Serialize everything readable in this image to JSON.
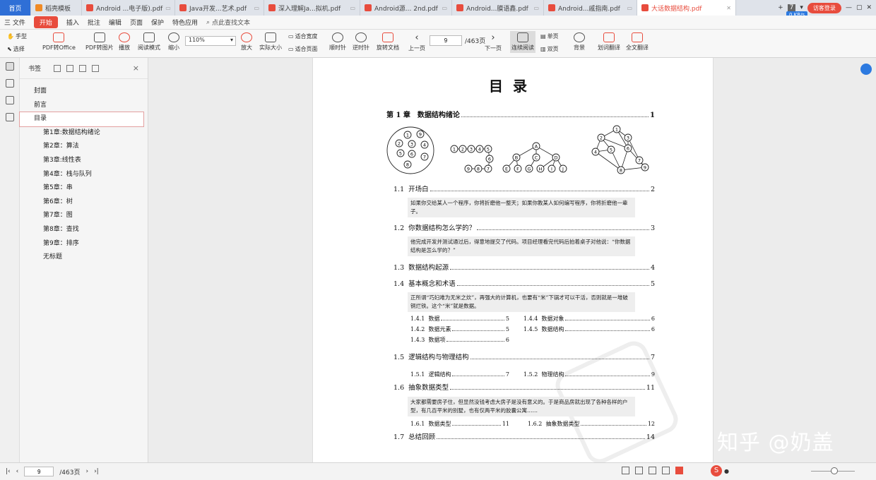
{
  "tabs": [
    {
      "label": "首页",
      "kind": "home"
    },
    {
      "label": "稻壳模板",
      "kind": "orange"
    },
    {
      "label": "Android ...电子版).pdf",
      "kind": "pdf"
    },
    {
      "label": "Java开发...艺术.pdf",
      "kind": "pdf"
    },
    {
      "label": "深入理解Ja...拟机.pdf",
      "kind": "pdf"
    },
    {
      "label": "Android源... 2nd.pdf",
      "kind": "pdf"
    },
    {
      "label": "Android...膜语鑫.pdf",
      "kind": "pdf"
    },
    {
      "label": "Android...戚指南.pdf",
      "kind": "pdf"
    },
    {
      "label": "大话数据结构.pdf",
      "kind": "active"
    }
  ],
  "tab_count": "7",
  "visit_login": "访客登录",
  "net_speed": "0 KB/s",
  "menu": {
    "file": "三 文件",
    "start": "开始",
    "items": [
      "插入",
      "批注",
      "编辑",
      "页面",
      "保护",
      "特色应用"
    ],
    "search": "点此查找文本"
  },
  "ribbon": {
    "hand": "手型",
    "select": "选择",
    "pdf_office": "PDF转Office",
    "pdf_image": "PDF转图片",
    "play": "播放",
    "read_mode": "阅读模式",
    "zoom_value": "110%",
    "shrink": "缩小",
    "enlarge": "放大",
    "actual": "实际大小",
    "fit_width": "适合宽度",
    "fit_page": "适合页面",
    "cw": "顺时针",
    "ccw": "逆时针",
    "rotate": "旋转文档",
    "prev": "上一页",
    "page_num": "9",
    "page_total": "/463页",
    "next": "下一页",
    "continuous": "连续阅读",
    "single": "单页",
    "double": "双页",
    "background": "背景",
    "line_translate": "划词翻译",
    "full_translate": "全文翻译"
  },
  "bookmarks": {
    "title": "书签",
    "items": [
      {
        "label": "封面",
        "level": 0
      },
      {
        "label": "前言",
        "level": 0
      },
      {
        "label": "目录",
        "level": 0,
        "selected": true
      },
      {
        "label": "第1章:数据结构绪论",
        "level": 1
      },
      {
        "label": "第2章：算法",
        "level": 1
      },
      {
        "label": "第3章:线性表",
        "level": 1
      },
      {
        "label": "第4章：栈与队列",
        "level": 1
      },
      {
        "label": "第5章：串",
        "level": 1
      },
      {
        "label": "第6章：树",
        "level": 1
      },
      {
        "label": "第7章：图",
        "level": 1
      },
      {
        "label": "第8章：查找",
        "level": 1
      },
      {
        "label": "第9章：排序",
        "level": 1
      },
      {
        "label": "无标题",
        "level": 1
      }
    ]
  },
  "document": {
    "title": "目录",
    "chapter": {
      "label": "第 1 章　数据结构绪论",
      "page": "1"
    },
    "sections": [
      {
        "num": "1.1",
        "label": "开场白",
        "page": "2"
      },
      {
        "num": "1.2",
        "label": "你数据结构怎么学的？",
        "page": "3"
      },
      {
        "num": "1.3",
        "label": "数据结构起源",
        "page": "4"
      },
      {
        "num": "1.4",
        "label": "基本概念和术语",
        "page": "5"
      },
      {
        "num": "1.5",
        "label": "逻辑结构与物理结构",
        "page": "7"
      },
      {
        "num": "1.6",
        "label": "抽象数据类型",
        "page": "11"
      },
      {
        "num": "1.7",
        "label": "总结回顾",
        "page": "14"
      }
    ],
    "quotes": [
      "如果你交给某人一个程序，你将折磨他一整天；如果你教某人如何编写程序，你将折磨他一辈子。",
      "他完成开发并测试通过后，得意地提交了代码。项目经理看完代码后拍着桌子对他说：“你数据结构是怎么学的？”",
      "正所谓“巧妇难为无米之炊”，再强大的计算机，也要有“米”下锅才可以干活，否则就是一堆破铜烂铁。这个“米”就是数据。",
      "大家都需要房子住，但显然没钱考虑大房子是没有意义的。于是商品房就出现了各种各样的户型，有几百平米的别墅，也有仅两平米的胶囊公寓……"
    ],
    "subsections_14": [
      {
        "num": "1.4.1",
        "label": "数据",
        "page": "5"
      },
      {
        "num": "1.4.4",
        "label": "数据对象",
        "page": "6"
      },
      {
        "num": "1.4.2",
        "label": "数据元素",
        "page": "5"
      },
      {
        "num": "1.4.5",
        "label": "数据结构",
        "page": "6"
      },
      {
        "num": "1.4.3",
        "label": "数据项",
        "page": "6"
      }
    ],
    "subsections_15": [
      {
        "num": "1.5.1",
        "label": "逻辑结构",
        "page": "7"
      },
      {
        "num": "1.5.2",
        "label": "物理结构",
        "page": "9"
      }
    ],
    "subsections_16": [
      {
        "num": "1.6.1",
        "label": "数据类型",
        "page": "11"
      },
      {
        "num": "1.6.2",
        "label": "抽象数据类型",
        "page": "12"
      }
    ],
    "diagram_set": {
      "set_nodes": [
        "1",
        "2",
        "3",
        "4",
        "5",
        "6",
        "7",
        "8",
        "9"
      ],
      "linear_nodes": [
        "1",
        "2",
        "3",
        "4",
        "5",
        "6",
        "7",
        "8",
        "9"
      ],
      "tree_nodes": [
        "A",
        "B",
        "C",
        "D",
        "E",
        "F",
        "G",
        "H",
        "I",
        "J"
      ],
      "graph_nodes": [
        "1",
        "2",
        "3",
        "4",
        "5",
        "6",
        "7",
        "8",
        "9"
      ]
    }
  },
  "watermark": "知乎 @奶盖",
  "status": {
    "page": "9",
    "total": "/463页"
  }
}
